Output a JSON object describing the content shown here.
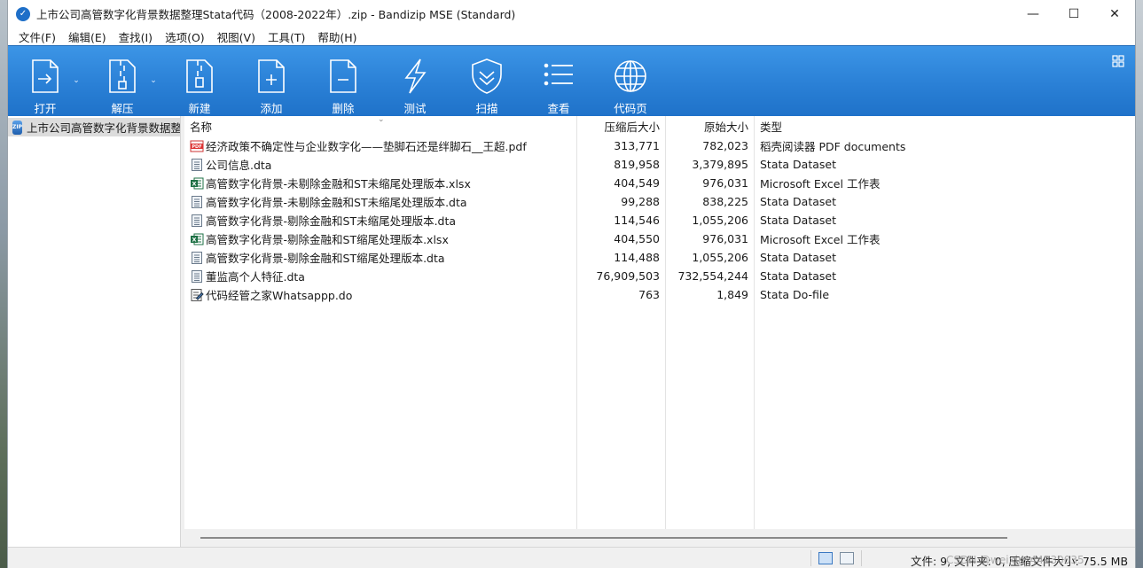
{
  "window": {
    "title": "上市公司高管数字化背景数据整理Stata代码（2008-2022年）.zip - Bandizip MSE (Standard)",
    "icon": "bandizip-icon",
    "controls": {
      "minimize": "—",
      "maximize": "☐",
      "close": "✕"
    }
  },
  "menu": [
    {
      "label": "文件(F)"
    },
    {
      "label": "编辑(E)"
    },
    {
      "label": "查找(I)"
    },
    {
      "label": "选项(O)"
    },
    {
      "label": "视图(V)"
    },
    {
      "label": "工具(T)"
    },
    {
      "label": "帮助(H)"
    }
  ],
  "toolbar": {
    "open": {
      "label": "打开",
      "icon": "open-file-icon"
    },
    "extract": {
      "label": "解压",
      "icon": "extract-zipper-icon"
    },
    "new": {
      "label": "新建",
      "icon": "new-archive-icon"
    },
    "add": {
      "label": "添加",
      "icon": "add-file-icon"
    },
    "delete": {
      "label": "删除",
      "icon": "delete-file-icon"
    },
    "test": {
      "label": "测试",
      "icon": "test-bolt-icon"
    },
    "scan": {
      "label": "扫描",
      "icon": "scan-shield-icon"
    },
    "view": {
      "label": "查看",
      "icon": "list-view-icon"
    },
    "codepage": {
      "label": "代码页",
      "icon": "globe-icon"
    }
  },
  "tree": {
    "root_label": "上市公司高管数字化背景数据整"
  },
  "columns": {
    "name": "名称",
    "compressed": "压缩后大小",
    "original": "原始大小",
    "type": "类型"
  },
  "files": [
    {
      "name": "经济政策不确定性与企业数字化——垫脚石还是绊脚石__王超.pdf",
      "compressed": "313,771",
      "original": "782,023",
      "type": "稻壳阅读器 PDF documents",
      "icon": "pdf"
    },
    {
      "name": "公司信息.dta",
      "compressed": "819,958",
      "original": "3,379,895",
      "type": "Stata Dataset",
      "icon": "dta"
    },
    {
      "name": "高管数字化背景-未剔除金融和ST未缩尾处理版本.xlsx",
      "compressed": "404,549",
      "original": "976,031",
      "type": "Microsoft Excel 工作表",
      "icon": "xlsx"
    },
    {
      "name": "高管数字化背景-未剔除金融和ST未缩尾处理版本.dta",
      "compressed": "99,288",
      "original": "838,225",
      "type": "Stata Dataset",
      "icon": "dta"
    },
    {
      "name": "高管数字化背景-剔除金融和ST未缩尾处理版本.dta",
      "compressed": "114,546",
      "original": "1,055,206",
      "type": "Stata Dataset",
      "icon": "dta"
    },
    {
      "name": "高管数字化背景-剔除金融和ST缩尾处理版本.xlsx",
      "compressed": "404,550",
      "original": "976,031",
      "type": "Microsoft Excel 工作表",
      "icon": "xlsx"
    },
    {
      "name": "高管数字化背景-剔除金融和ST缩尾处理版本.dta",
      "compressed": "114,488",
      "original": "1,055,206",
      "type": "Stata Dataset",
      "icon": "dta"
    },
    {
      "name": "董监高个人特征.dta",
      "compressed": "76,909,503",
      "original": "732,554,244",
      "type": "Stata Dataset",
      "icon": "dta"
    },
    {
      "name": "代码经管之家Whatsappp.do",
      "compressed": "763",
      "original": "1,849",
      "type": "Stata Do-file",
      "icon": "do"
    }
  ],
  "status": {
    "text": "文件: 9, 文件夹: 0, 压缩文件大小: 75.5 MB",
    "watermark": "CSDN @weixin_44230035"
  }
}
